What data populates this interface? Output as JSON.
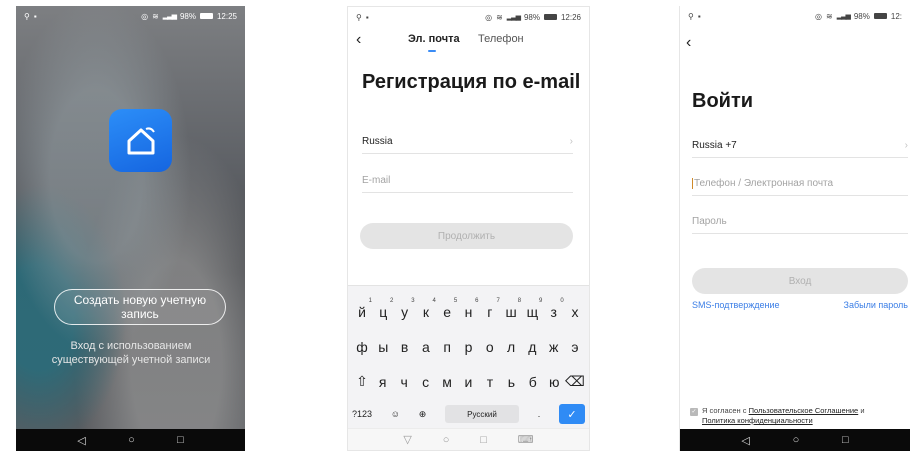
{
  "screen1": {
    "status_time": "12:25",
    "status_battery": "98%",
    "create_button": "Создать новую учетную запись",
    "login_link": "Вход с использованием существующей учетной записи"
  },
  "screen2": {
    "status_time": "12:26",
    "status_battery": "98%",
    "tab_email": "Эл. почта",
    "tab_phone": "Телефон",
    "title": "Регистрация по e-mail",
    "country": "Russia",
    "email_placeholder": "E-mail",
    "continue_button": "Продолжить",
    "keyboard": {
      "row1": [
        "й",
        "ц",
        "у",
        "к",
        "е",
        "н",
        "г",
        "ш",
        "щ",
        "з",
        "х"
      ],
      "row1_digits": [
        "1",
        "2",
        "3",
        "4",
        "5",
        "6",
        "7",
        "8",
        "9",
        "0",
        ""
      ],
      "row2": [
        "ф",
        "ы",
        "в",
        "а",
        "п",
        "р",
        "о",
        "л",
        "д",
        "ж",
        "э"
      ],
      "row3": [
        "я",
        "ч",
        "с",
        "м",
        "и",
        "т",
        "ь",
        "б",
        "ю"
      ],
      "mode_key": "?123",
      "space_label": "Русский",
      "period": "."
    }
  },
  "screen3": {
    "status_time": "12:",
    "status_battery": "98%",
    "title": "Войти",
    "country": "Russia +7",
    "login_placeholder": "Телефон / Электронная почта",
    "password_placeholder": "Пароль",
    "login_button": "Вход",
    "sms_link": "SMS-подтверждение",
    "forgot_link": "Забыли пароль",
    "agree_prefix": "Я согласен с",
    "agree_terms": "Пользовательское Соглашение",
    "agree_and": "и",
    "agree_privacy": "Политика конфиденциальности"
  },
  "colors": {
    "accent": "#3b8cf5",
    "app_icon": "#1f78f0",
    "link": "#3b7ee6",
    "disabled_button": "#e4e4e4"
  },
  "icons": [
    "back-arrow-icon",
    "chevron-right-icon",
    "home-app-icon",
    "nav-back-icon",
    "nav-home-icon",
    "nav-recent-icon",
    "backspace-icon",
    "globe-icon",
    "checkmark-icon"
  ]
}
